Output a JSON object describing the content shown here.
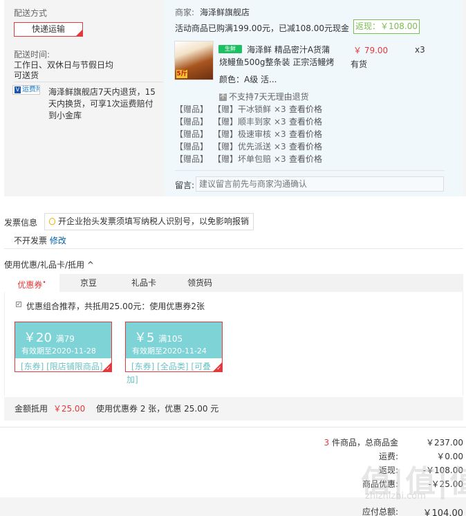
{
  "delivery": {
    "section_label": "配送方式",
    "method_button": "快递运输",
    "time_label": "配送时间:",
    "time_value_1": "工作日、双休日与节假日均",
    "time_value_2": "可送货",
    "insurance_badge": "运费险",
    "insurance_text_1": "海泽鲜旗舰店7天内退货，15",
    "insurance_text_2": "天内换货，可享1次运费赔付",
    "insurance_text_3": "到小金库"
  },
  "shop": {
    "merchant_label": "商家:",
    "merchant_name": "海泽鲜旗舰店",
    "promo_text": "活动商品已购满199.00元，已减108.00元现金",
    "cashback": "返现：￥108.00",
    "product": {
      "fresh_badge": "生鲜",
      "title_1": "海泽鲜 精品密汁A货蒲",
      "title_2": "烧鳗鱼500g整条装 正宗活鳗烤",
      "image_tag": "5斤",
      "price": "￥ 79.00",
      "quantity": "x3",
      "stock": "有货",
      "color_label": "颜色：",
      "color_value": "A级 活...",
      "no_return_icon": "不",
      "no_return": "不支持7天无理由退货"
    },
    "gifts": [
      {
        "tag1": "【赠品】",
        "tag2": "【赠】",
        "name": "干冰锁鲜",
        "qty": "×3",
        "action": "查看价格"
      },
      {
        "tag1": "【赠品】",
        "tag2": "【赠】",
        "name": "顺丰到家",
        "qty": "×3",
        "action": "查看价格"
      },
      {
        "tag1": "【赠品】",
        "tag2": "【赠】",
        "name": "极速审核",
        "qty": "×3",
        "action": "查看价格"
      },
      {
        "tag1": "【赠品】",
        "tag2": "【赠】",
        "name": "优先派送",
        "qty": "×3",
        "action": "查看价格"
      },
      {
        "tag1": "【赠品】",
        "tag2": "【赠】",
        "name": "坏单包赔",
        "qty": "×3",
        "action": "查看价格"
      }
    ],
    "remark_label": "留言:",
    "remark_placeholder": "建议留言前先与商家沟通确认"
  },
  "invoice": {
    "title": "发票信息",
    "tip": "开企业抬头发票须填写纳税人识别号，以免影响报销",
    "value": "不开发票",
    "modify": "修改"
  },
  "discount": {
    "title": "使用优惠/礼品卡/抵用",
    "toggle_icon": "^",
    "tabs": [
      {
        "label": "优惠券",
        "mark": "•"
      },
      {
        "label": "京豆"
      },
      {
        "label": "礼品卡"
      },
      {
        "label": "领货码"
      }
    ],
    "recommend_check": "✓",
    "recommend": "优惠组合推荐，共抵用25.00元：使用优惠券2张",
    "coupons": [
      {
        "symbol": "￥",
        "amount": "20",
        "threshold": "满79",
        "expiry": "有效期至2020-11-28",
        "scope": "[东券] [限店铺限商品]"
      },
      {
        "symbol": "￥",
        "amount": "5",
        "threshold": "满105",
        "expiry": "有效期至2020-11-24",
        "scope_1": "[东券] [全品类] [可叠",
        "scope_2": "加]"
      }
    ],
    "deduct_label": "金额抵用",
    "deduct_value": "￥25.00",
    "deduct_summary": "使用优惠券 2 张，优惠 25.00 元"
  },
  "summary": {
    "item_count": "3",
    "items_label": "件商品，总商品金",
    "items_value": "￥237.00",
    "shipping_label": "运费:",
    "shipping_value": "￥0.00",
    "row3_label": "返现:",
    "row3_value": "-￥108.00",
    "row4_label": "商品优惠:",
    "row4_value": "-￥25.00",
    "pay_label": "应付总额:",
    "pay_value": "￥104.00"
  },
  "watermark": {
    "big": "值|值|值",
    "small": "zhizhizhi.com"
  },
  "colors": {
    "accent": "#e4393c",
    "link": "#005ea7",
    "cashback": "#7abd54",
    "coupon": "#7ed3d6"
  }
}
